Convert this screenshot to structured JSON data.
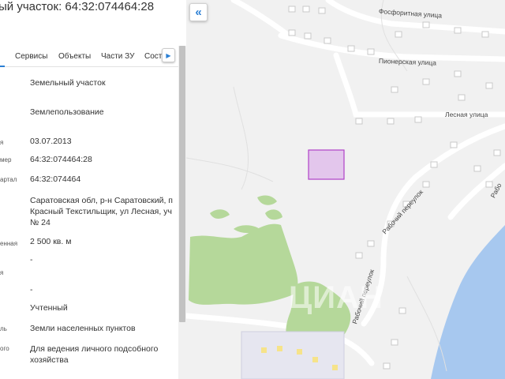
{
  "panel": {
    "title": "ый участок: 64:32:074464:28",
    "tabs": [
      "Сервисы",
      "Объекты",
      "Части ЗУ",
      "Соста"
    ],
    "rows": [
      {
        "label": "",
        "value": "Земельный участок"
      },
      {
        "label": "",
        "value": "Землепользование"
      },
      {
        "label": "я",
        "value": "03.07.2013"
      },
      {
        "label": "мер",
        "value": "64:32:074464:28"
      },
      {
        "label": "артал",
        "value": "64:32:074464"
      },
      {
        "label": "",
        "value_lines": [
          "Саратовская обл, р-н Саратовский, п",
          "Красный Текстильщик, ул Лесная, уч",
          "№ 24"
        ]
      },
      {
        "label": "енная",
        "value": "2 500 кв. м"
      },
      {
        "label": "я",
        "value": "-"
      },
      {
        "label": "",
        "value": "-"
      },
      {
        "label": "",
        "value": "Учтенный"
      },
      {
        "label": "ль",
        "value": "Земли населенных пунктов"
      },
      {
        "label": "ого",
        "value_lines": [
          "Для ведения личного подсобного",
          "хозяйства"
        ]
      }
    ]
  },
  "map": {
    "collapse_icon": "«",
    "streets": [
      "Фосфоритная улица",
      "Пионерская улица",
      "Лесная улица",
      "Рабочий переулок",
      "Рабочий переулок",
      "Рабо"
    ],
    "watermark": "ЦИАН",
    "colors": {
      "background": "#f1f1f1",
      "parcel_fill": "#e3c6ec",
      "parcel_stroke": "#b041c8",
      "forest": "#b5d89a",
      "water": "#a7c8ef",
      "building": "#ffffff",
      "building_stroke": "#c9c9c9",
      "road": "#ffffff"
    }
  }
}
